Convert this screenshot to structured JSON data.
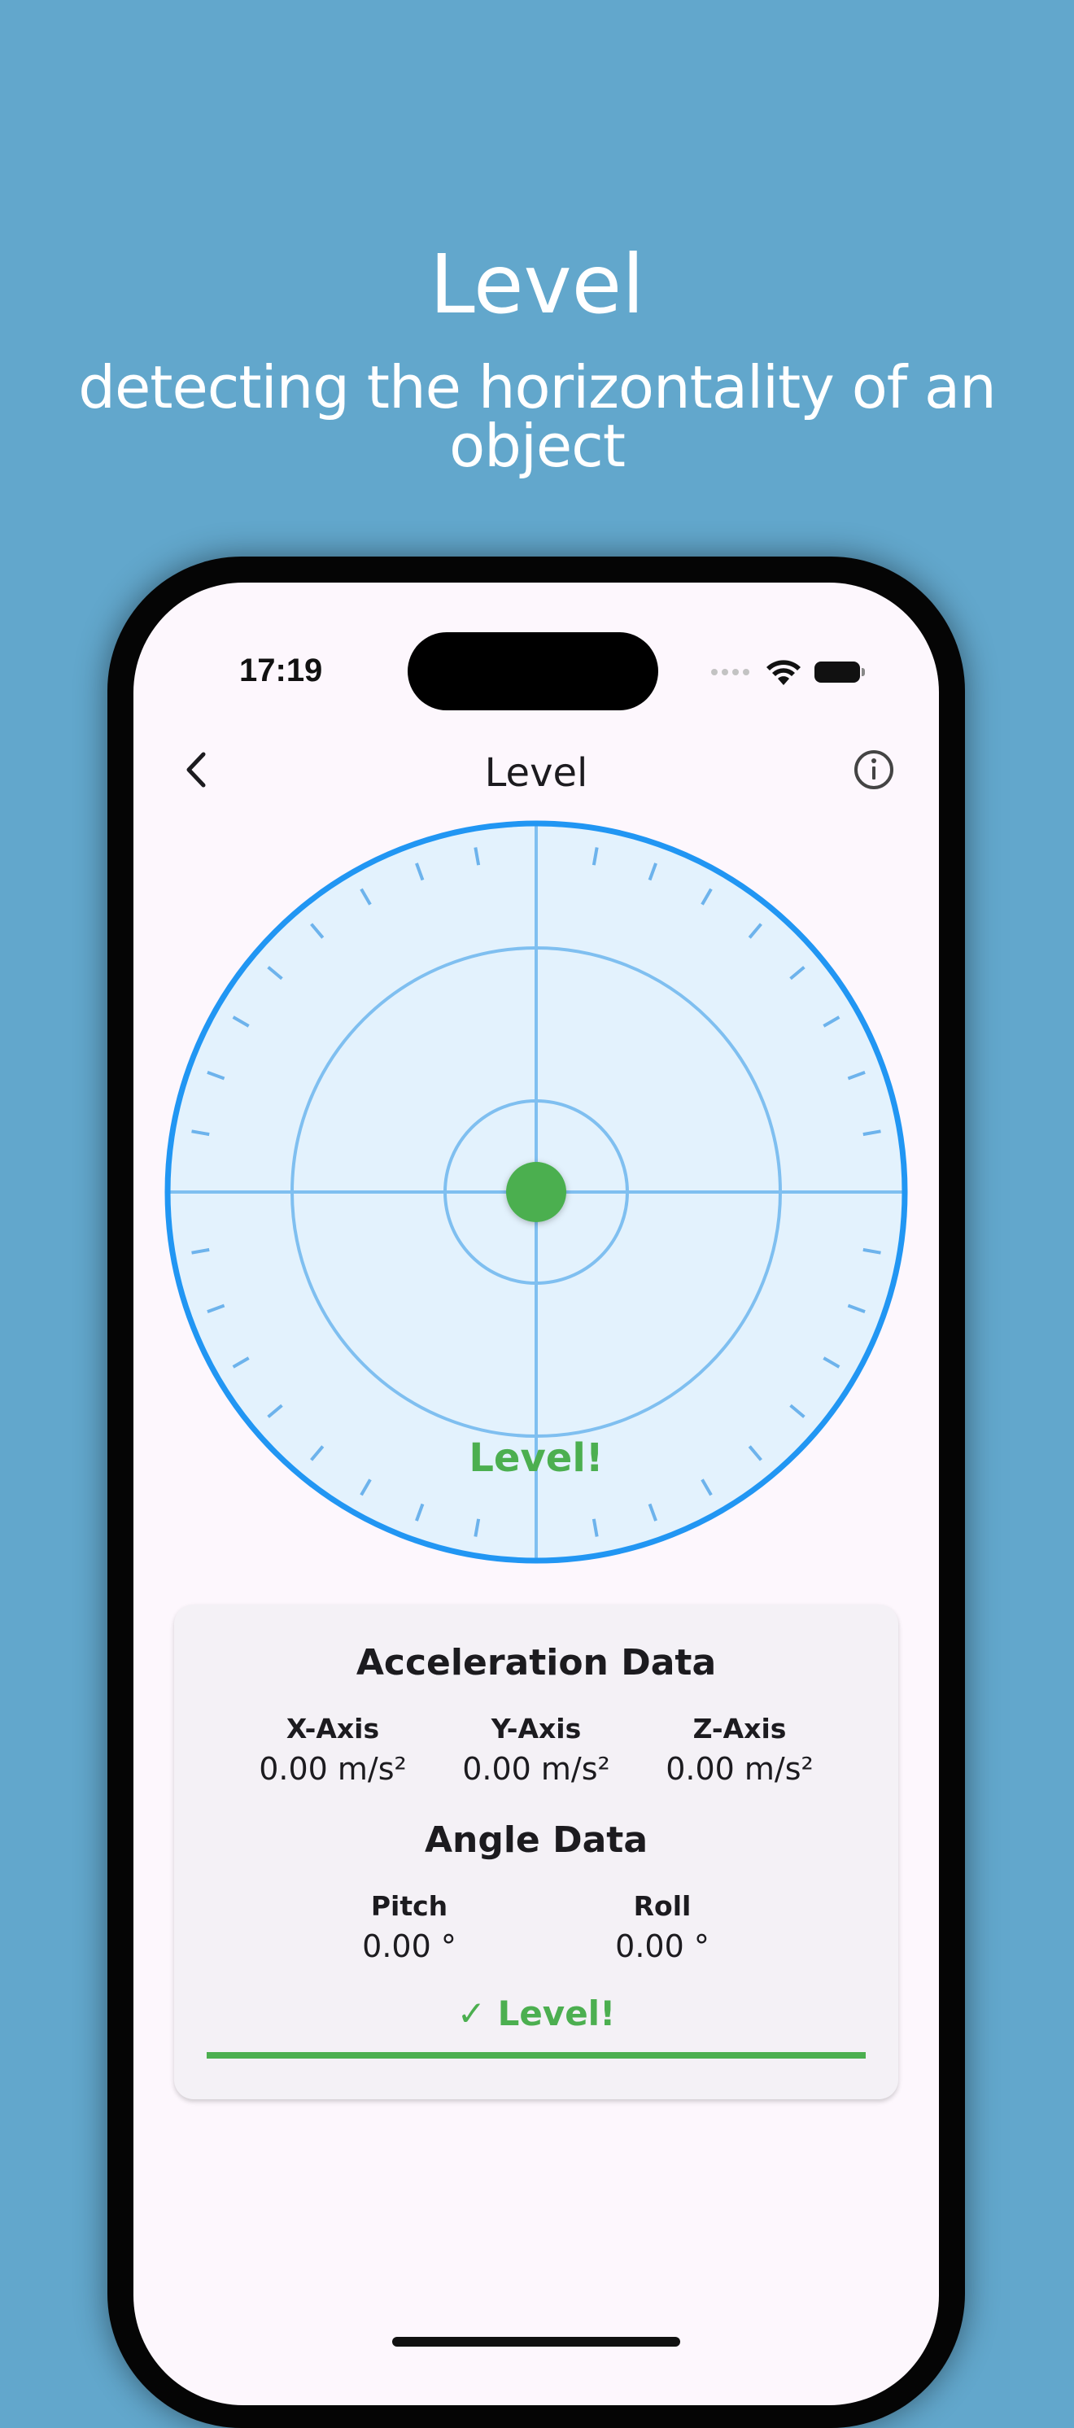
{
  "promo": {
    "title": "Level",
    "subtitle": "detecting the horizontality of an object"
  },
  "status_bar": {
    "time": "17:19",
    "icons": [
      "cellular-signal-icon",
      "wifi-icon",
      "battery-icon"
    ]
  },
  "nav": {
    "title": "Level",
    "back_icon": "chevron-left-icon",
    "info_icon": "info-circle-icon"
  },
  "dial": {
    "status": "Level!",
    "bubble_offset_x": 0.0,
    "bubble_offset_y": 0.0,
    "colors": {
      "ring": "#2196f3",
      "fill": "#e3f2fd",
      "lines": "#7fbff0",
      "bubble": "#4caf50"
    }
  },
  "acceleration": {
    "heading": "Acceleration Data",
    "axes": [
      {
        "label": "X-Axis",
        "value": "0.00 m/s²"
      },
      {
        "label": "Y-Axis",
        "value": "0.00 m/s²"
      },
      {
        "label": "Z-Axis",
        "value": "0.00 m/s²"
      }
    ]
  },
  "angle": {
    "heading": "Angle Data",
    "items": [
      {
        "label": "Pitch",
        "value": "0.00 °"
      },
      {
        "label": "Roll",
        "value": "0.00 °"
      }
    ]
  },
  "card_status": {
    "text": "✓ Level!",
    "progress": 1.0,
    "color": "#4caf50"
  }
}
